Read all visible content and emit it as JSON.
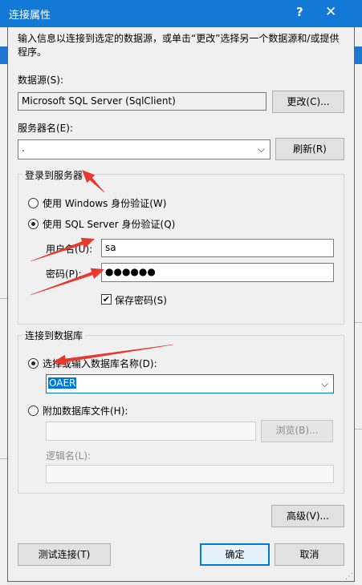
{
  "window": {
    "title": "连接属性",
    "help": "?",
    "close": "✕"
  },
  "intro": "输入信息以连接到选定的数据源，或单击“更改”选择另一个数据源和/或提供程序。",
  "datasource": {
    "label": "数据源(S):",
    "value": "Microsoft SQL Server (SqlClient)",
    "change_button": "更改(C)..."
  },
  "server": {
    "label": "服务器名(E):",
    "value": ".",
    "refresh_button": "刷新(R)"
  },
  "login": {
    "legend": "登录到服务器",
    "windows_auth": "使用 Windows 身份验证(W)",
    "sql_auth": "使用 SQL Server 身份验证(Q)",
    "selected": "sql_auth",
    "username_label": "用户名(U):",
    "username": "sa",
    "password_label": "密码(P):",
    "password_mask": "●●●●●●",
    "save_password": "保存密码(S)",
    "save_password_checked": true
  },
  "database": {
    "legend": "连接到数据库",
    "select_option": "选择或输入数据库名称(D):",
    "selected_db": "OAER",
    "attach_option": "附加数据库文件(H):",
    "browse_button": "浏览(B)...",
    "logical_name_label": "逻辑名(L):"
  },
  "buttons": {
    "advanced": "高级(V)...",
    "test": "测试连接(T)",
    "ok": "确定",
    "cancel": "取消"
  },
  "annotation_color": "#e8392f"
}
